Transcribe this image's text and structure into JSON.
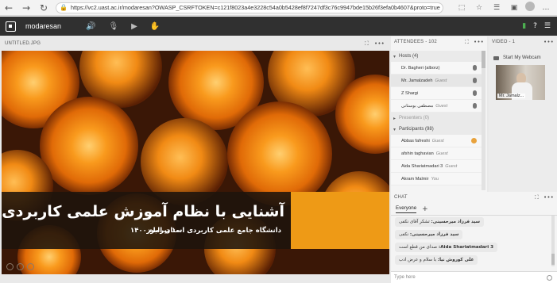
{
  "browser": {
    "url": "https://vc2.uast.ac.ir/modaresan?OWASP_CSRFTOKEN=c121f8023a4e3228c54a0b5428ef8f7247df3c76c9947bde15b26f3efa0b4607&proto=true"
  },
  "app": {
    "name": "modaresan",
    "accent_color": "#59c0a8"
  },
  "presentation": {
    "header": "UNTITLED.JPG",
    "title": "آشنایی با نظام آموزش علمی کاربردی",
    "subtitle": "دانشگاه جامع علمی کاربردی استان البرز",
    "date": "۱۰ تیرماه ۱۴۰۰",
    "panel_orange": "#ee9a16"
  },
  "attendees": {
    "header": "ATTENDEES - 102",
    "hosts": {
      "label": "Hosts (4)",
      "rows": [
        {
          "name": "Dr. Bagheri (alborz)",
          "role": ""
        },
        {
          "name": "Mr. Jamalzadeh",
          "role": "Guest"
        },
        {
          "name": "Z Shargi",
          "role": ""
        },
        {
          "name": "مصطفی بوستانی",
          "role": "Guest"
        }
      ]
    },
    "presenters": {
      "label": "Presenters (0)"
    },
    "participants": {
      "label": "Participants (98)",
      "rows": [
        {
          "name": "Abbas fafreshi",
          "role": "Guest"
        },
        {
          "name": "afshin taghavian",
          "role": "Guest"
        },
        {
          "name": "Aida Shariatmadari 3",
          "role": "Guest"
        },
        {
          "name": "Akram Malmir",
          "role": "You"
        }
      ]
    }
  },
  "video": {
    "header": "VIDEO - 1",
    "start_webcam": "Start My Webcam",
    "tile_name": "Mr. Jamalz..."
  },
  "chat": {
    "header": "CHAT",
    "tab": "Everyone",
    "messages": [
      {
        "who": "سید فرزاد میرحسینی:",
        "text": "تشکر آقای نکفی"
      },
      {
        "who": "سید فرزاد میرحسینی:",
        "text": "نکفی"
      },
      {
        "who": "Aida Shariatmadari 3:",
        "text": "صدای من قطع است"
      },
      {
        "who": "علی کوروش نیا:",
        "text": "با سلام و عرض ادب"
      }
    ],
    "placeholder": "Type here"
  }
}
